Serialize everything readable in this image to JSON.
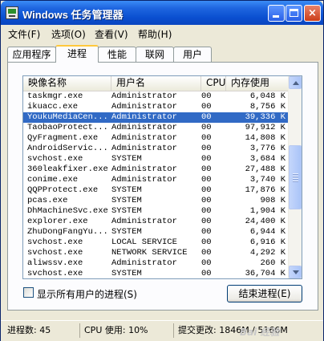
{
  "window": {
    "title": "Windows 任务管理器"
  },
  "title_buttons": {
    "close": "×"
  },
  "menu": [
    "文件(F)",
    "选项(O)",
    "查看(V)",
    "帮助(H)"
  ],
  "tabs": [
    "应用程序",
    "进程",
    "性能",
    "联网",
    "用户"
  ],
  "active_tab": "进程",
  "columns": [
    "映像名称",
    "用户名",
    "CPU",
    "内存使用"
  ],
  "processes": [
    {
      "name": "taskmgr.exe",
      "user": "Administrator",
      "cpu": "00",
      "mem": "6,048 K"
    },
    {
      "name": "ikuacc.exe",
      "user": "Administrator",
      "cpu": "00",
      "mem": "8,756 K"
    },
    {
      "name": "YoukuMediaCen...",
      "user": "Administrator",
      "cpu": "00",
      "mem": "39,336 K",
      "selected": true
    },
    {
      "name": "TaobaoProtect...",
      "user": "Administrator",
      "cpu": "00",
      "mem": "97,912 K"
    },
    {
      "name": "QyFragment.exe",
      "user": "Administrator",
      "cpu": "00",
      "mem": "14,808 K"
    },
    {
      "name": "AndroidServic...",
      "user": "Administrator",
      "cpu": "00",
      "mem": "3,776 K"
    },
    {
      "name": "svchost.exe",
      "user": "SYSTEM",
      "cpu": "00",
      "mem": "3,684 K"
    },
    {
      "name": "360leakfixer.exe",
      "user": "Administrator",
      "cpu": "00",
      "mem": "27,488 K"
    },
    {
      "name": "conime.exe",
      "user": "Administrator",
      "cpu": "00",
      "mem": "3,740 K"
    },
    {
      "name": "QQPProtect.exe",
      "user": "SYSTEM",
      "cpu": "00",
      "mem": "17,876 K"
    },
    {
      "name": "pcas.exe",
      "user": "SYSTEM",
      "cpu": "00",
      "mem": "908 K"
    },
    {
      "name": "DhMachineSvc.exe",
      "user": "SYSTEM",
      "cpu": "00",
      "mem": "1,904 K"
    },
    {
      "name": "explorer.exe",
      "user": "Administrator",
      "cpu": "00",
      "mem": "24,400 K"
    },
    {
      "name": "ZhuDongFangYu...",
      "user": "SYSTEM",
      "cpu": "00",
      "mem": "6,944 K"
    },
    {
      "name": "svchost.exe",
      "user": "LOCAL SERVICE",
      "cpu": "00",
      "mem": "6,916 K"
    },
    {
      "name": "svchost.exe",
      "user": "NETWORK SERVICE",
      "cpu": "00",
      "mem": "4,292 K"
    },
    {
      "name": "aliwssv.exe",
      "user": "Administrator",
      "cpu": "00",
      "mem": "260 K"
    },
    {
      "name": "svchost.exe",
      "user": "SYSTEM",
      "cpu": "00",
      "mem": "36,704 K"
    }
  ],
  "show_all_users_label": "显示所有用户的进程(S)",
  "end_process_label": "结束进程(E)",
  "status": {
    "process_count": "进程数: 45",
    "cpu_usage": "CPU 使用: 10%",
    "commit_charge": "提交更改: 1846M / 5166M"
  },
  "watermark": "Bai 经验"
}
